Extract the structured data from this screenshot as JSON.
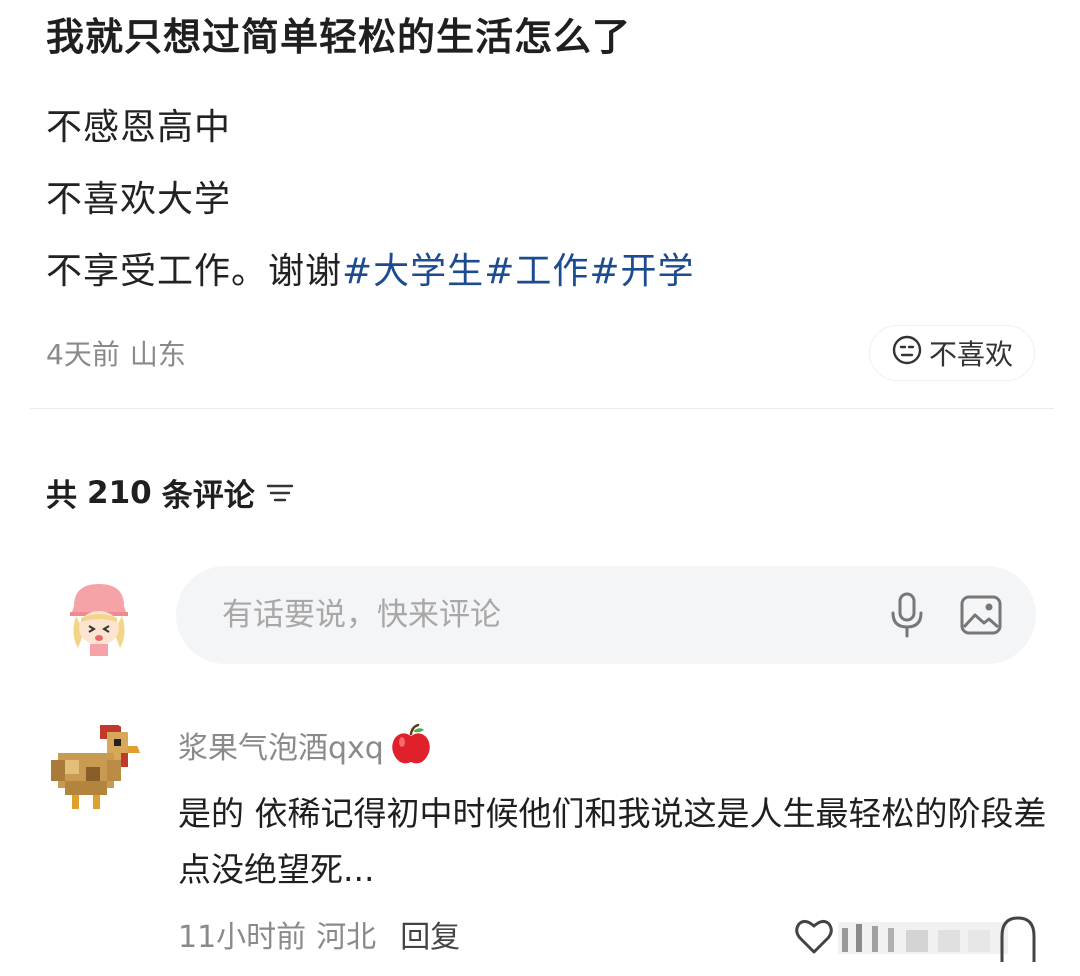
{
  "post": {
    "title": "我就只想过简单轻松的生活怎么了",
    "lines": [
      "不感恩高中",
      "不喜欢大学"
    ],
    "last_line_prefix": "不享受工作。谢谢",
    "hashtags": [
      "#大学生",
      "#工作",
      "#开学"
    ],
    "time": "4天前",
    "location": "山东",
    "dislike_label": "不喜欢"
  },
  "comments_header": {
    "prefix": "共",
    "count": "210",
    "suffix": "条评论"
  },
  "comment_input": {
    "placeholder": "有话要说，快来评论"
  },
  "comments": [
    {
      "username": "浆果气泡酒qxq",
      "text": "是的 依稀记得初中时候他们和我说这是人生最轻松的阶段差点没绝望死...",
      "time": "11小时前",
      "location": "河北",
      "reply_label": "回复"
    }
  ],
  "icons": {
    "dislike": "neutral-face-icon",
    "sort": "sort-filter-icon",
    "mic": "microphone-icon",
    "image": "image-icon",
    "apple": "red-apple-emoji",
    "like": "heart-icon"
  },
  "colors": {
    "hashtag": "#1d4b8f",
    "meta": "#8a8a8a",
    "input_bg": "#f4f5f7"
  }
}
